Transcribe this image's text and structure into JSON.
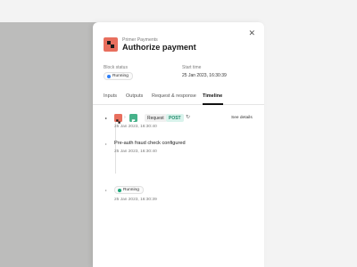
{
  "panel": {
    "app_name": "Primer Payments",
    "title": "Authorize payment",
    "close_icon": "close-icon",
    "logo_icon": "primer-logo-icon"
  },
  "fields": {
    "block_status_label": "Block status",
    "block_status_value": "Running",
    "block_status_color": "#2d7ff9",
    "start_time_label": "Start time",
    "start_time_value": "25 Jan 2023, 16:30:39"
  },
  "tabs": [
    {
      "label": "Inputs",
      "active": false
    },
    {
      "label": "Outputs",
      "active": false
    },
    {
      "label": "Request & response",
      "active": false
    },
    {
      "label": "Timeline",
      "active": true
    }
  ],
  "timeline": [
    {
      "request_label": "Request",
      "method": "POST",
      "time": "25 Jan 2023, 16:30:40",
      "details_link": "See details",
      "source_icon": "primer-logo-icon",
      "target_icon": "service-logo-icon",
      "loading_icon": "spinner-icon"
    },
    {
      "text": "Pre-auth fraud check configured",
      "time": "25 Jan 2023, 16:30:40"
    },
    {
      "status": "Running",
      "status_color": "#1fa67a",
      "time": "25 Jan 2023, 16:30:39"
    }
  ],
  "colors": {
    "brand": "#e86f5e",
    "method_post_bg": "#d9f3ec",
    "method_post_text": "#1f8a6a"
  }
}
